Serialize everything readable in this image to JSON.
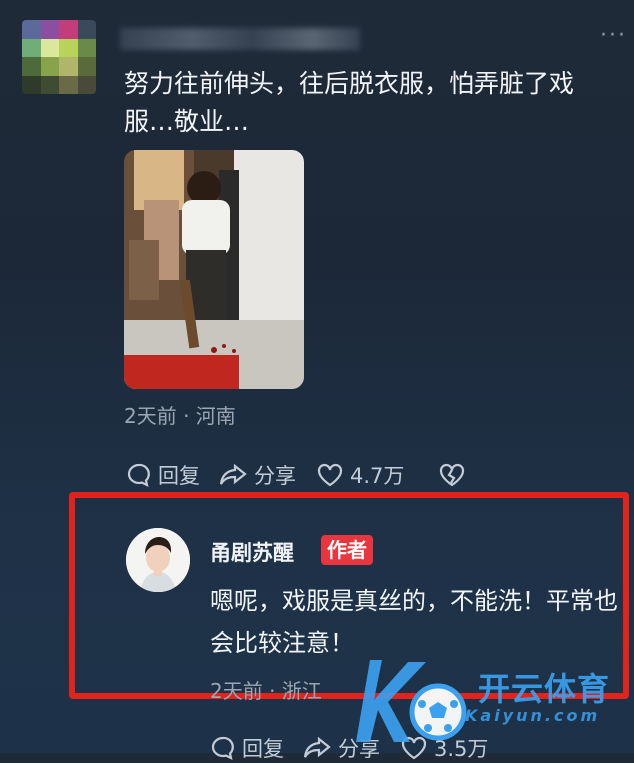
{
  "post": {
    "comment_text": "努力往前伸头，往后脱衣服，怕弄脏了戏服…敬业…",
    "meta": "2天前 · 河南",
    "actions": {
      "reply": "回复",
      "share": "分享",
      "likes": "4.7万"
    }
  },
  "reply": {
    "author_name": "甬剧苏醒",
    "author_badge": "作者",
    "text": "嗯呢，戏服是真丝的，不能洗！平常也会比较注意！",
    "meta": "2天前 · 浙江",
    "actions": {
      "reply": "回复",
      "share": "分享",
      "likes": "3.5万"
    }
  },
  "watermark": {
    "brand": "开云体育",
    "domain": "Kaiyun.com"
  },
  "colors": {
    "highlight_border": "#e2231a",
    "badge_bg": "#e9353e",
    "watermark": "#3ba0ee"
  }
}
